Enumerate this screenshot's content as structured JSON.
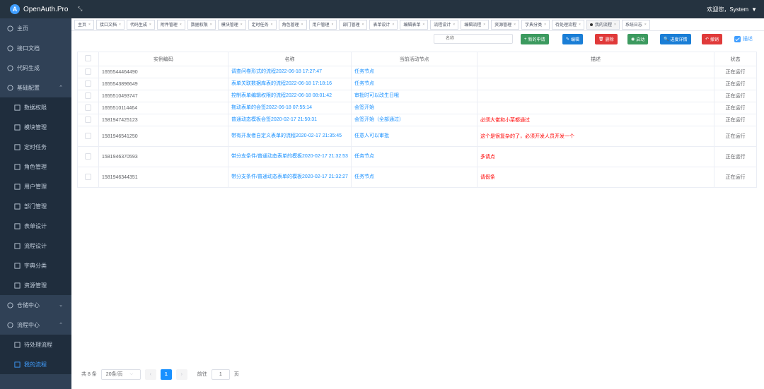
{
  "app": {
    "title": "OpenAuth.Pro",
    "welcome": "欢迎您，System"
  },
  "sidebar": {
    "items": [
      {
        "label": "主页",
        "level": 0
      },
      {
        "label": "接口文档",
        "level": 0
      },
      {
        "label": "代码生成",
        "level": 0
      },
      {
        "label": "基础配置",
        "level": 0,
        "expanded": true
      },
      {
        "label": "数据权限",
        "level": 1
      },
      {
        "label": "模块管理",
        "level": 1
      },
      {
        "label": "定时任务",
        "level": 1
      },
      {
        "label": "角色管理",
        "level": 1
      },
      {
        "label": "用户管理",
        "level": 1
      },
      {
        "label": "部门管理",
        "level": 1
      },
      {
        "label": "表单设计",
        "level": 1
      },
      {
        "label": "流程设计",
        "level": 1
      },
      {
        "label": "字典分类",
        "level": 1
      },
      {
        "label": "资源管理",
        "level": 1
      },
      {
        "label": "仓储中心",
        "level": 0
      },
      {
        "label": "流程中心",
        "level": 0,
        "expanded": true
      },
      {
        "label": "待处理流程",
        "level": 1
      },
      {
        "label": "我的流程",
        "level": 1,
        "active": true
      }
    ]
  },
  "tabs": [
    "主页",
    "接口文档",
    "代码生成",
    "附件管理",
    "数据权限",
    "模块管理",
    "定时任务",
    "角色管理",
    "用户管理",
    "部门管理",
    "表单设计",
    "编辑表单",
    "流程设计",
    "编辑流程",
    "资源管理",
    "字典分类",
    "待处理流程",
    "我的流程",
    "系统日志"
  ],
  "active_tab": "我的流程",
  "toolbar": {
    "search_placeholder": "名称",
    "buttons": [
      {
        "label": "新的申请",
        "color": "#3c9a5f",
        "icon": "+"
      },
      {
        "label": "编辑",
        "color": "#1a7ed6",
        "icon": "✎"
      },
      {
        "label": "删除",
        "color": "#e03a3a",
        "icon": "🗑"
      },
      {
        "label": "启动",
        "color": "#3c9a5f",
        "icon": "◉"
      },
      {
        "label": "进度详情",
        "color": "#1a7ed6",
        "icon": "🔍"
      },
      {
        "label": "撤销",
        "color": "#e03a3a",
        "icon": "↶"
      }
    ],
    "desc_checkbox_label": "描述"
  },
  "table": {
    "headers": [
      "实例编码",
      "名称",
      "当前活动节点",
      "描述",
      "状态"
    ],
    "rows": [
      {
        "code": "1655544464490",
        "name": "调查问卷形式的流程2022-06-18 17:27:47",
        "node": "任务节点",
        "desc": "",
        "status": "正在运行"
      },
      {
        "code": "1655543896649",
        "name": "表单关联数据库表的流程2022-06-18 17:18:16",
        "node": "任务节点",
        "desc": "",
        "status": "正在运行"
      },
      {
        "code": "1655510493747",
        "name": "控制表单编辑权限的流程2022-06-18 08:01:42",
        "node": "审批时可以改生日哦",
        "desc": "",
        "status": "正在运行"
      },
      {
        "code": "1655510114464",
        "name": "拖动表单的会签2022-06-18 07:55:14",
        "node": "会签开始",
        "desc": "",
        "status": "正在运行"
      },
      {
        "code": "1581947425123",
        "name": "普通动态模板会签2020-02-17 21:50:31",
        "node": "会签开始（全部通过）",
        "desc": "必须大佬和小菜都通过",
        "status": "正在运行"
      },
      {
        "code": "1581946541250",
        "name": "带有开发者自定义表单的流程2020-02-17 21:35:45",
        "node": "任意人可以审批",
        "desc": "这个是很复杂的了，必须开发人员开发一个",
        "status": "正在运行"
      },
      {
        "code": "1581946370593",
        "name": "带分支条件/普通动态表单的模板2020-02-17 21:32:53",
        "node": "任务节点",
        "desc": "多请点",
        "status": "正在运行"
      },
      {
        "code": "1581946344351",
        "name": "带分支条件/普通动态表单的模板2020-02-17 21:32:27",
        "node": "任务节点",
        "desc": "请假条",
        "status": "正在运行"
      }
    ]
  },
  "pagination": {
    "total": "共 8 条",
    "page_size": "20条/页",
    "current": "1",
    "goto_label": "前往",
    "goto_value": "1",
    "page_suffix": "页"
  }
}
